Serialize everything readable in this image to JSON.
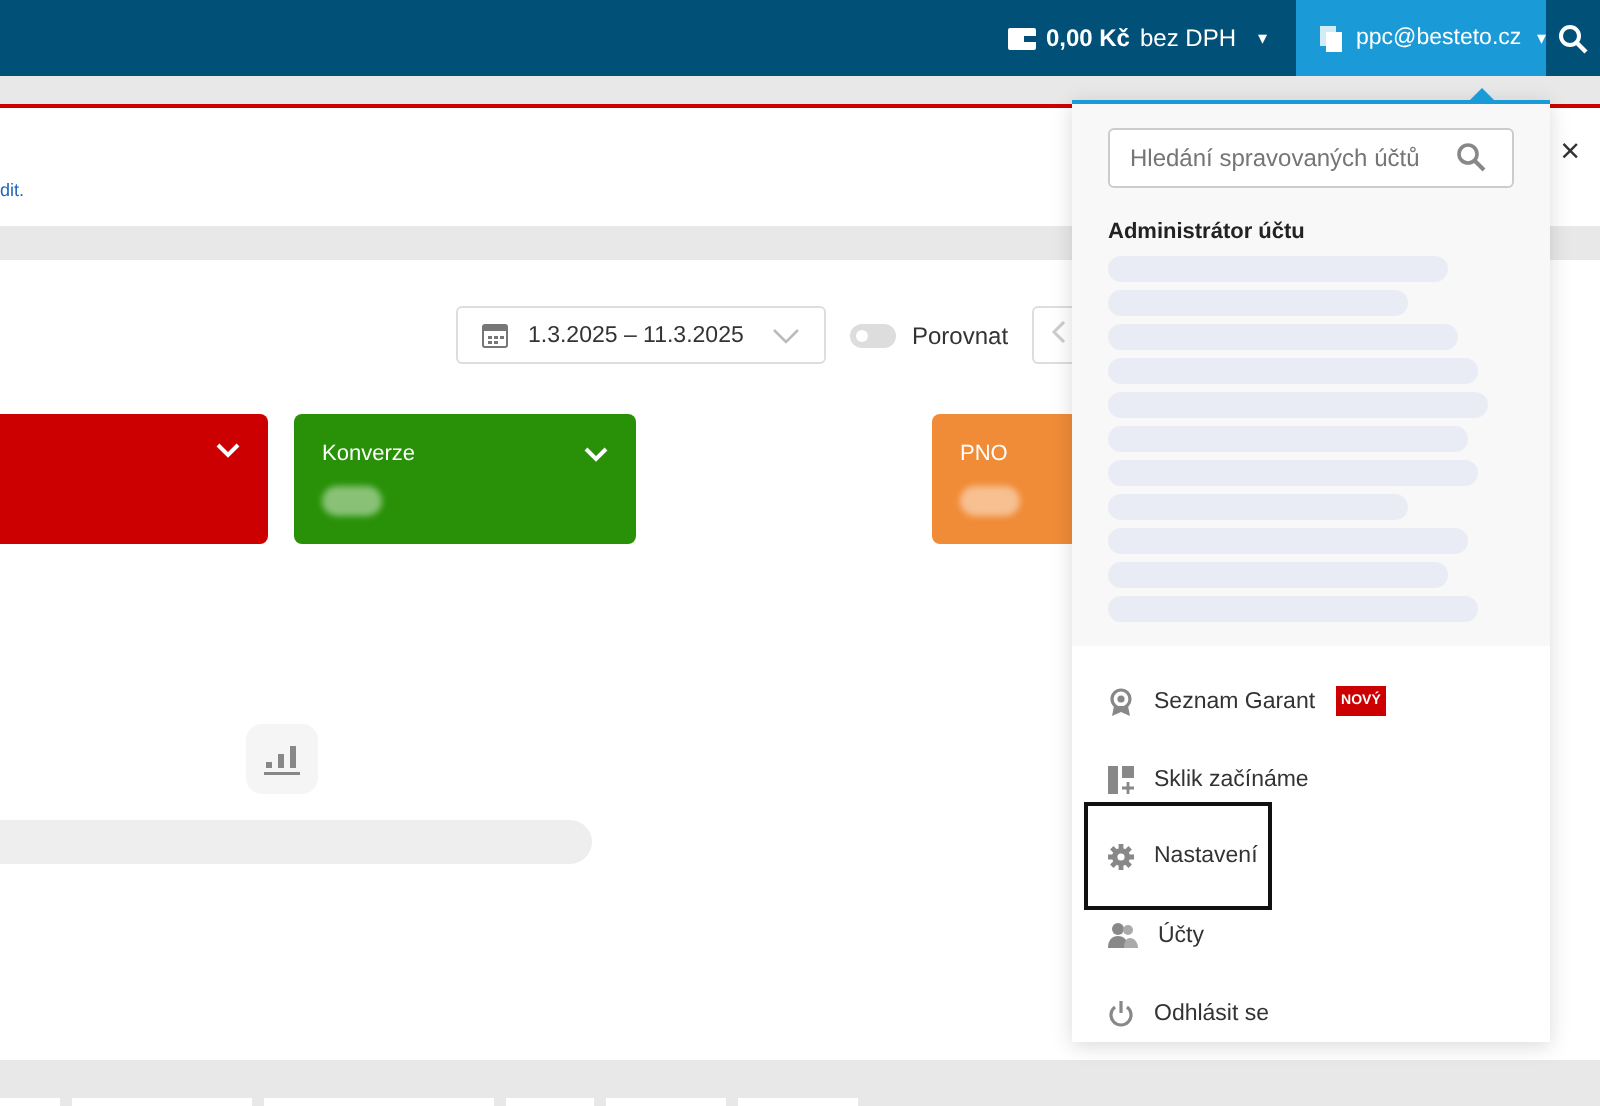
{
  "top_bar": {
    "balance_amount": "0,00 Kč",
    "balance_note": "bez DPH",
    "balance_caret": "▾",
    "account": "ppc@besteto.cz",
    "account_caret": "▾",
    "account_open": true
  },
  "notice": {
    "link": "dit.",
    "close": "×"
  },
  "toolbar": {
    "date_range": "1.3.2025 – 11.3.2025",
    "compare_label": "Porovnat",
    "compare_on": false
  },
  "cards": [
    {
      "color": "#cc0000",
      "expandable": true
    },
    {
      "label": "Konverze",
      "color": "#289107",
      "expandable": true
    },
    {
      "label": "PNO",
      "color": "#f08c38"
    }
  ],
  "account_menu": {
    "search": {
      "placeholder": "Hledání spravovaných účtů"
    },
    "section_title": "Administrátor účtu",
    "items": [
      {
        "kind": "award",
        "label": "Seznam Garant",
        "badge": "NOVÝ",
        "highlighted": false
      },
      {
        "kind": "start",
        "label": "Sklik začínáme",
        "highlighted": false
      },
      {
        "kind": "settings",
        "label": "Nastavení",
        "highlighted": true
      },
      {
        "kind": "accounts",
        "label": "Účty",
        "highlighted": false
      },
      {
        "kind": "logout",
        "label": "Odhlásit se",
        "highlighted": false
      }
    ]
  }
}
